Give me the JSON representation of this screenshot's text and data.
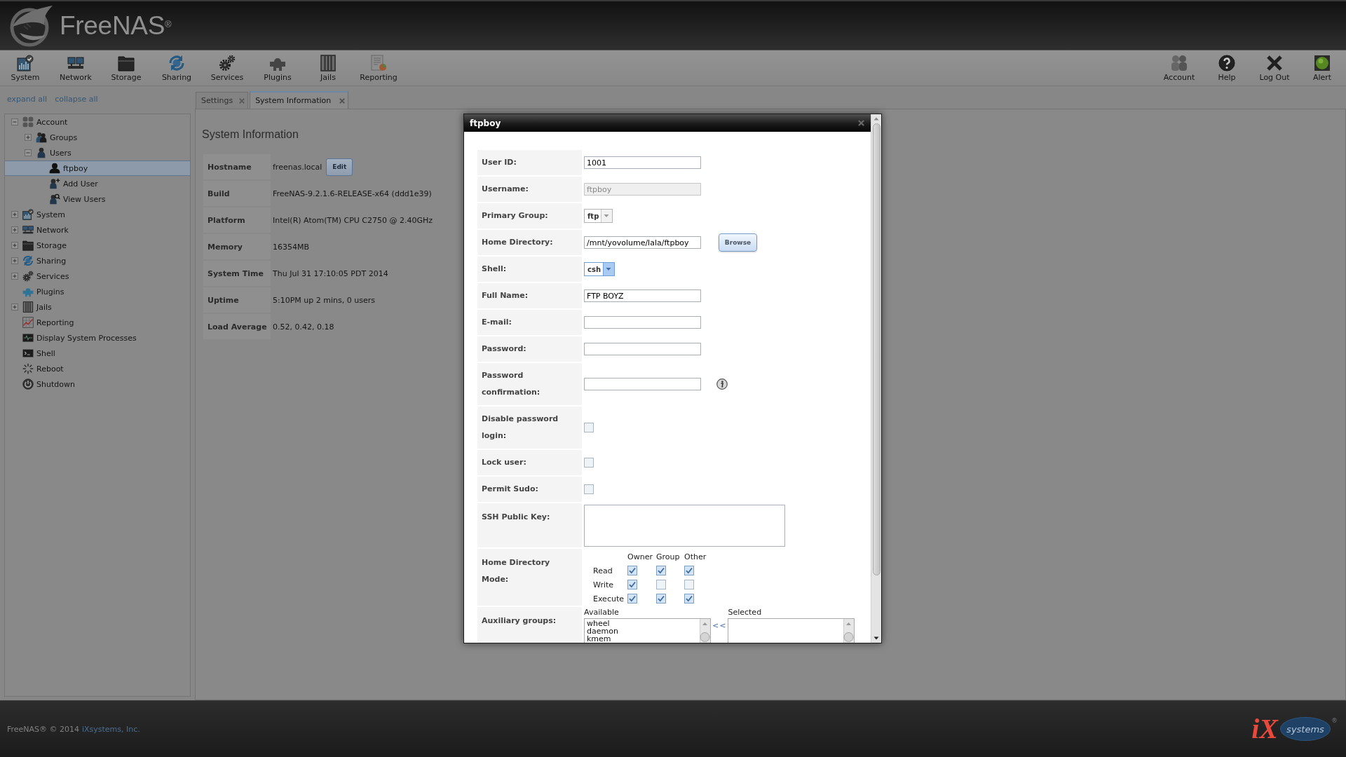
{
  "header": {
    "logo": "FreeNAS$^{®}$"
  },
  "toolbar": {
    "left": [
      {
        "label": "System",
        "kind": "system"
      },
      {
        "label": "Network",
        "kind": "network"
      },
      {
        "label": "Storage",
        "kind": "storage"
      },
      {
        "label": "Sharing",
        "kind": "sharing"
      },
      {
        "label": "Services",
        "kind": "services"
      },
      {
        "label": "Plugins",
        "kind": "plugins"
      },
      {
        "label": "Jails",
        "kind": "jails"
      },
      {
        "label": "Reporting",
        "kind": "reporting"
      }
    ],
    "right": [
      {
        "label": "Account",
        "kind": "account"
      },
      {
        "label": "Help",
        "kind": "help"
      },
      {
        "label": "Log Out",
        "kind": "logout"
      },
      {
        "label": "Alert",
        "kind": "alert"
      }
    ]
  },
  "sidebar": {
    "links": [
      "expand all",
      "collapse all"
    ],
    "tree": [
      {
        "label": "Account",
        "kind": "account",
        "expanded": true,
        "selected": false,
        "children": [
          {
            "label": "Groups",
            "kind": "groups",
            "expanded": false,
            "selected": false
          },
          {
            "label": "Users",
            "kind": "user",
            "expanded": true,
            "selected": false,
            "children": [
              {
                "label": "ftpboy",
                "kind": "person",
                "selected": true
              },
              {
                "label": "Add User",
                "kind": "add-user",
                "selected": false
              },
              {
                "label": "View Users",
                "kind": "view-users",
                "selected": false
              }
            ]
          }
        ]
      },
      {
        "label": "System",
        "kind": "system",
        "expanded": false,
        "selected": false
      },
      {
        "label": "Network",
        "kind": "network",
        "expanded": false,
        "selected": false
      },
      {
        "label": "Storage",
        "kind": "storage",
        "expanded": false,
        "selected": false
      },
      {
        "label": "Sharing",
        "kind": "sharing",
        "expanded": false,
        "selected": false
      },
      {
        "label": "Services",
        "kind": "services",
        "expanded": false,
        "selected": false
      },
      {
        "label": "Plugins",
        "kind": "plugins",
        "selected": false
      },
      {
        "label": "Jails",
        "kind": "jails",
        "expanded": false,
        "selected": false
      },
      {
        "label": "Reporting",
        "kind": "reporting",
        "selected": false
      },
      {
        "label": "Display System Processes",
        "kind": "processes",
        "selected": false
      },
      {
        "label": "Shell",
        "kind": "shell",
        "selected": false
      },
      {
        "label": "Reboot",
        "kind": "reboot",
        "selected": false
      },
      {
        "label": "Shutdown",
        "kind": "shutdown",
        "selected": false
      }
    ]
  },
  "tabs": [
    {
      "label": "Settings",
      "selected": false
    },
    {
      "label": "System Information",
      "selected": true
    }
  ],
  "system_info": {
    "title": "System Information",
    "rows": [
      {
        "label": "Hostname",
        "value": "freenas.local",
        "button": "Edit"
      },
      {
        "label": "Build",
        "value": "FreeNAS-9.2.1.6-RELEASE-x64 (ddd1e39)"
      },
      {
        "label": "Platform",
        "value": "Intel(R) Atom(TM) CPU C2750 @ 2.40GHz"
      },
      {
        "label": "Memory",
        "value": "16354MB"
      },
      {
        "label": "System Time",
        "value": "Thu Jul 31 17:10:05 PDT 2014"
      },
      {
        "label": "Uptime",
        "value": "5:10PM up 2 mins, 0 users"
      },
      {
        "label": "Load Average",
        "value": "0.52, 0.42, 0.18"
      }
    ]
  },
  "dialog": {
    "title": "ftpboy",
    "fields": [
      {
        "kind": "text",
        "label": "User ID:",
        "value": "1001",
        "disabled": false
      },
      {
        "kind": "text",
        "label": "Username:",
        "value": "ftpboy",
        "disabled": true
      },
      {
        "kind": "select",
        "label": "Primary Group:",
        "value": "ftp",
        "focused": false
      },
      {
        "kind": "text",
        "label": "Home Directory:",
        "value": "/mnt/yovolume/lala/ftpboy",
        "disabled": false,
        "button": "Browse"
      },
      {
        "kind": "select",
        "label": "Shell:",
        "value": "csh",
        "focused": true
      },
      {
        "kind": "text",
        "label": "Full Name:",
        "value": "FTP BOYZ",
        "disabled": false
      },
      {
        "kind": "text",
        "label": "E-mail:",
        "disabled": false
      },
      {
        "kind": "password",
        "label": "Password:"
      },
      {
        "kind": "password",
        "label": "Password confirmation:",
        "info": true
      },
      {
        "kind": "checkbox",
        "label": "Disable password login:",
        "checked": false
      },
      {
        "kind": "checkbox",
        "label": "Lock user:",
        "checked": false
      },
      {
        "kind": "checkbox",
        "label": "Permit Sudo:",
        "checked": false
      },
      {
        "kind": "textarea",
        "label": "SSH Public Key:"
      },
      {
        "kind": "mode",
        "label": "Home Directory Mode:",
        "columns": [
          "Owner",
          "Group",
          "Other"
        ],
        "rows": [
          {
            "label": "Read",
            "cells": [
              {
                "checked": true
              },
              {
                "checked": true
              },
              {
                "checked": true
              }
            ]
          },
          {
            "label": "Write",
            "cells": [
              {
                "checked": true
              },
              {
                "checked": false
              },
              {
                "checked": false
              }
            ]
          },
          {
            "label": "Execute",
            "cells": [
              {
                "checked": true
              },
              {
                "checked": true
              },
              {
                "checked": true
              }
            ]
          }
        ]
      },
      {
        "kind": "groups",
        "label": "Auxiliary groups:",
        "available_label": "Available",
        "available": [
          "wheel",
          "daemon",
          "kmem"
        ],
        "move": "<<",
        "selected_label": "Selected"
      }
    ]
  },
  "footer": {
    "copyright": "FreeNAS® © 2014",
    "company": "iXsystems, Inc.",
    "logo": {
      "mark": "iX",
      "name": "systems",
      "trademark": "®"
    }
  }
}
